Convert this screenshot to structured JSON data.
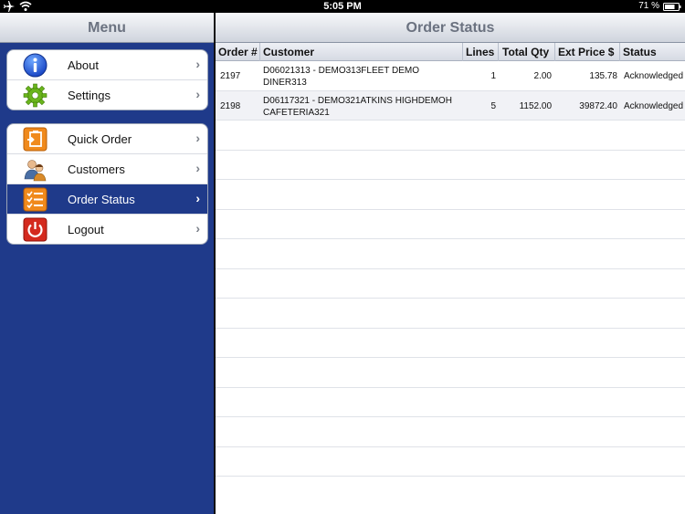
{
  "status_bar": {
    "time": "5:05 PM",
    "battery_percent": "71 %"
  },
  "menu": {
    "title": "Menu",
    "group1": [
      {
        "label": "About",
        "icon": "info-icon"
      },
      {
        "label": "Settings",
        "icon": "gear-icon"
      }
    ],
    "group2": [
      {
        "label": "Quick Order",
        "icon": "quick-order-icon"
      },
      {
        "label": "Customers",
        "icon": "customers-icon"
      },
      {
        "label": "Order Status",
        "icon": "checklist-icon",
        "active": true
      },
      {
        "label": "Logout",
        "icon": "power-icon"
      }
    ]
  },
  "order_status": {
    "title": "Order Status",
    "columns": [
      "Order #",
      "Customer",
      "Lines",
      "Total Qty",
      "Ext Price $",
      "Status"
    ],
    "rows": [
      {
        "order": "2197",
        "customer": "D06021313 - DEMO313FLEET DEMO DINER313",
        "lines": "1",
        "total_qty": "2.00",
        "ext_price": "135.78",
        "status": "Acknowledged"
      },
      {
        "order": "2198",
        "customer": "D06117321 - DEMO321ATKINS HIGHDEMOH CAFETERIA321",
        "lines": "5",
        "total_qty": "1152.00",
        "ext_price": "39872.40",
        "status": "Acknowledged"
      }
    ]
  },
  "colors": {
    "menu_bg": "#1f3a8a",
    "active_item_bg": "#1f3a8a"
  }
}
